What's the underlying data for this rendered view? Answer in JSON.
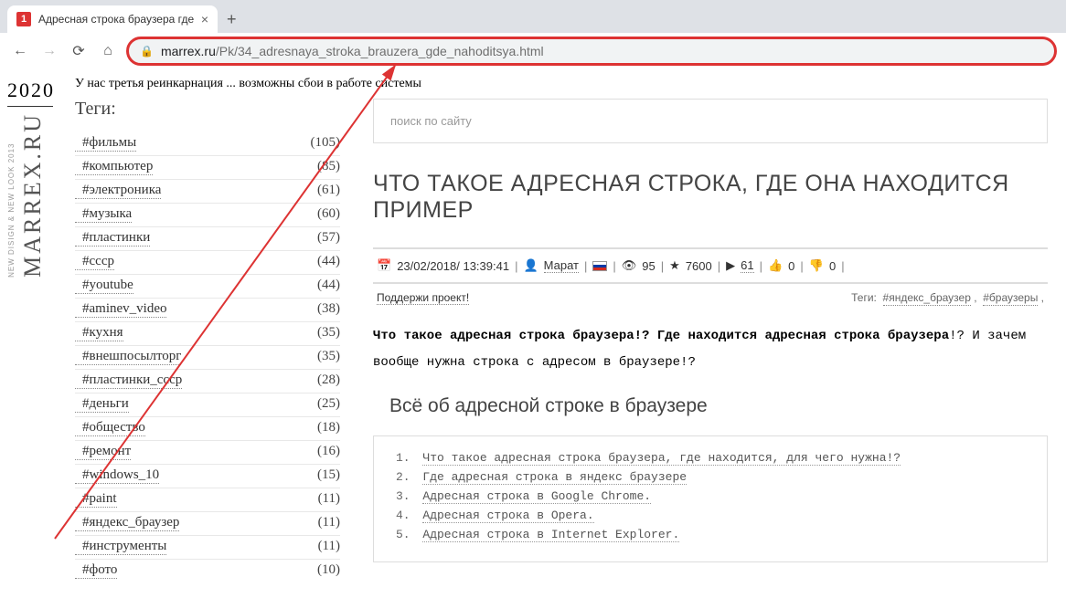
{
  "browser": {
    "tab": {
      "favicon_text": "1",
      "title": "Адресная строка браузера где"
    },
    "url_domain": "marrex.ru",
    "url_path": "/Pk/34_adresnaya_stroka_brauzera_gde_nahoditsya.html"
  },
  "rail": {
    "year": "2020",
    "site": "MARREX.RU",
    "tagline": "NEW DISIGN & NEW LOOK 2013"
  },
  "notice": "У нас третья реинкарнация ... возможны сбои в работе системы",
  "sidebar": {
    "title": "Теги:",
    "tags": [
      {
        "name": "#фильмы",
        "count": "(105)"
      },
      {
        "name": "#компьютер",
        "count": "(85)"
      },
      {
        "name": "#электроника",
        "count": "(61)"
      },
      {
        "name": "#музыка",
        "count": "(60)"
      },
      {
        "name": "#пластинки",
        "count": "(57)"
      },
      {
        "name": "#ссср",
        "count": "(44)"
      },
      {
        "name": "#youtube",
        "count": "(44)"
      },
      {
        "name": "#aminev_video",
        "count": "(38)"
      },
      {
        "name": "#кухня",
        "count": "(35)"
      },
      {
        "name": "#внешпосылторг",
        "count": "(35)"
      },
      {
        "name": "#пластинки_ссср",
        "count": "(28)"
      },
      {
        "name": "#деньги",
        "count": "(25)"
      },
      {
        "name": "#общество",
        "count": "(18)"
      },
      {
        "name": "#ремонт",
        "count": "(16)"
      },
      {
        "name": "#windows_10",
        "count": "(15)"
      },
      {
        "name": "#paint",
        "count": "(11)"
      },
      {
        "name": "#яндекс_браузер",
        "count": "(11)"
      },
      {
        "name": "#инструменты",
        "count": "(11)"
      },
      {
        "name": "#фото",
        "count": "(10)"
      }
    ]
  },
  "content": {
    "search_placeholder": "поиск по сайту",
    "title": "ЧТО ТАКОЕ АДРЕСНАЯ СТРОКА, ГДЕ ОНА НАХОДИТСЯ ПРИМЕР",
    "meta": {
      "date": "23/02/2018/ 13:39:41",
      "author": "Марат",
      "views": "95",
      "stars": "7600",
      "yt": "61",
      "up": "0",
      "down": "0"
    },
    "support": "Поддержи проект!",
    "tags_label": "Теги:",
    "tag1": "#яндекс_браузер",
    "tag2": "#браузеры",
    "intro_bold": "Что такое адресная строка браузера!? Где находится адресная строка браузера",
    "intro_rest": "!? И зачем вообще нужна строка с адресом в браузере!?",
    "section": "Всё об адресной строке в браузере",
    "toc": [
      "Что такое адресная строка браузера, где находится, для чего нужна!?",
      "Где адресная строка в яндекс браузере",
      "Адресная строка в Google Chrome.",
      "Адресная строка в Opera.",
      "Адресная строка в Internet Explorer."
    ]
  }
}
